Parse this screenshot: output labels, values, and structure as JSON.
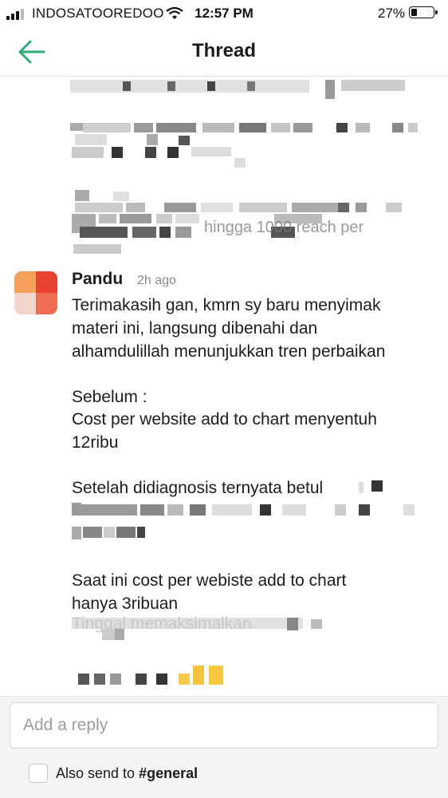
{
  "status_bar": {
    "carrier": "INDOSATOOREDOO",
    "time": "12:57 PM",
    "battery": "27%",
    "battery_level": 0.27
  },
  "header": {
    "title": "Thread",
    "back_icon": "arrow-left-icon",
    "accent": "#2bac76"
  },
  "thread": {
    "previous_message_fragments": {
      "line1": "…di kill?",
      "line2": "hingga 1000 reach per",
      "line3": "ad…"
    },
    "message": {
      "author": "Pandu",
      "time": "2h ago",
      "lines": [
        "Terimakasih gan, kmrn sy baru menyimak",
        "materi ini, langsung dibenahi dan",
        "alhamdulillah menunjukkan tren perbaikan",
        "Sebelum :",
        "Cost per website add to chart menyentuh",
        "12ribu",
        "Setelah didiagnosis ternyata betul",
        "Saat ini cost per webiste add to chart",
        "hanya 3ribuan",
        "Tinggal memaksimalkan"
      ]
    }
  },
  "composer": {
    "placeholder": "Add a reply",
    "also_send_prefix": "Also send to ",
    "channel": "#general"
  }
}
